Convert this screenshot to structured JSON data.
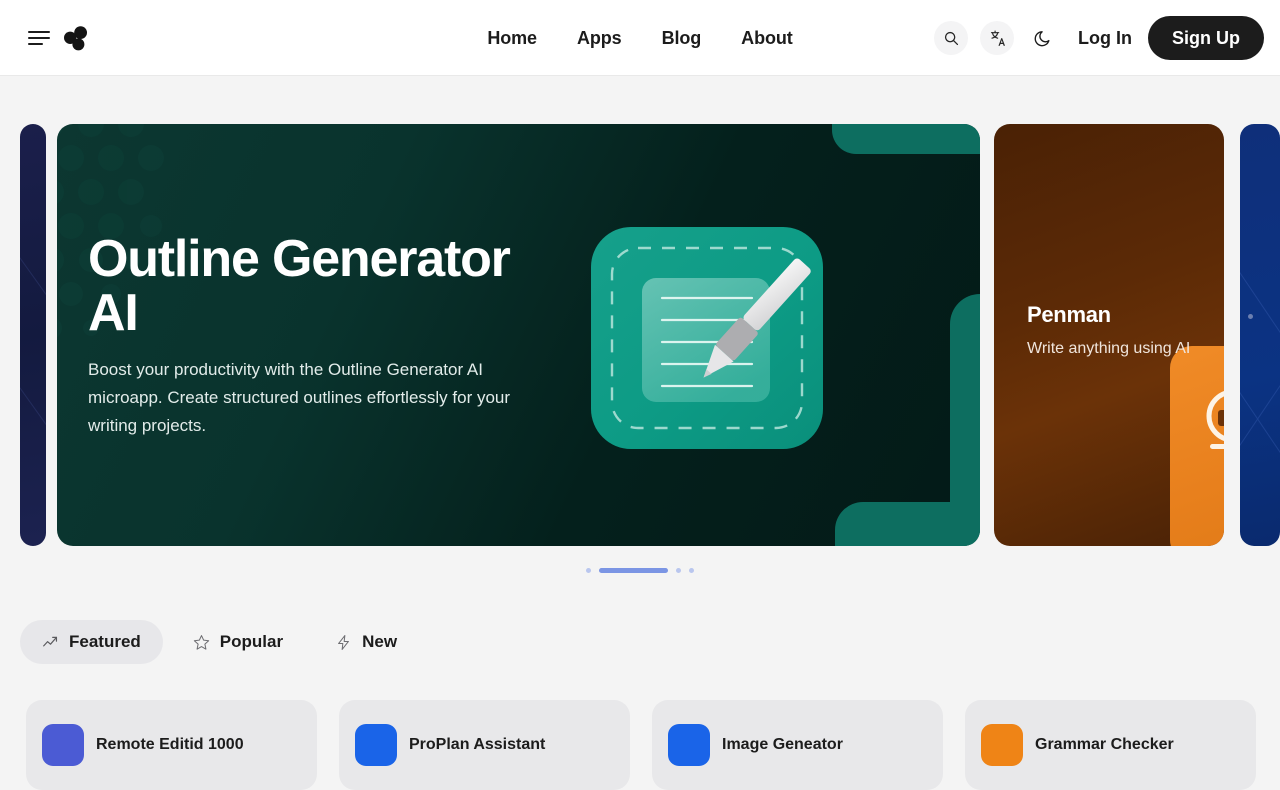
{
  "header": {
    "menu_icon": "hamburger-icon",
    "logo_icon": "three-circles-logo",
    "nav": [
      {
        "label": "Home"
      },
      {
        "label": "Apps"
      },
      {
        "label": "Blog"
      },
      {
        "label": "About"
      }
    ],
    "actions": {
      "search_icon": "search-icon",
      "language_icon": "translate-icon",
      "theme_icon": "moon-icon",
      "login_label": "Log In",
      "signup_label": "Sign Up"
    }
  },
  "carousel": {
    "hero": {
      "title": "Outline Generator AI",
      "description": "Boost your productivity with the Outline Generator AI microapp. Create structured outlines effortlessly for your writing projects.",
      "illustration": "notepad-with-pen-icon",
      "bg_color": "#09332d",
      "accent_color": "#0d6e60"
    },
    "next_card": {
      "title": "Penman",
      "description": "Write anything using AI",
      "illustration": "pen-circle-icon",
      "bg_color": "#5c2a06",
      "accent_color": "#e8801d"
    },
    "prev_sliver": {
      "bg_color": "#1b1f4b"
    },
    "far_sliver": {
      "bg_color": "#0b3383"
    },
    "indicators": [
      {
        "state": "inactive"
      },
      {
        "state": "active"
      },
      {
        "state": "inactive"
      },
      {
        "state": "inactive"
      }
    ],
    "active_color": "#7b95e4",
    "inactive_color": "#b9c6ee"
  },
  "filters": [
    {
      "label": "Featured",
      "icon": "trending-up-icon",
      "active": true
    },
    {
      "label": "Popular",
      "icon": "star-icon",
      "active": false
    },
    {
      "label": "New",
      "icon": "lightning-icon",
      "active": false
    }
  ],
  "app_cards": [
    {
      "name": "Remote Editid 1000",
      "icon_color": "#4b5bd4"
    },
    {
      "name": "ProPlan Assistant",
      "icon_color": "#1a64e8"
    },
    {
      "name": "Image Geneator",
      "icon_color": "#1a64e8"
    },
    {
      "name": "Grammar Checker",
      "icon_color": "#ef8416"
    }
  ]
}
